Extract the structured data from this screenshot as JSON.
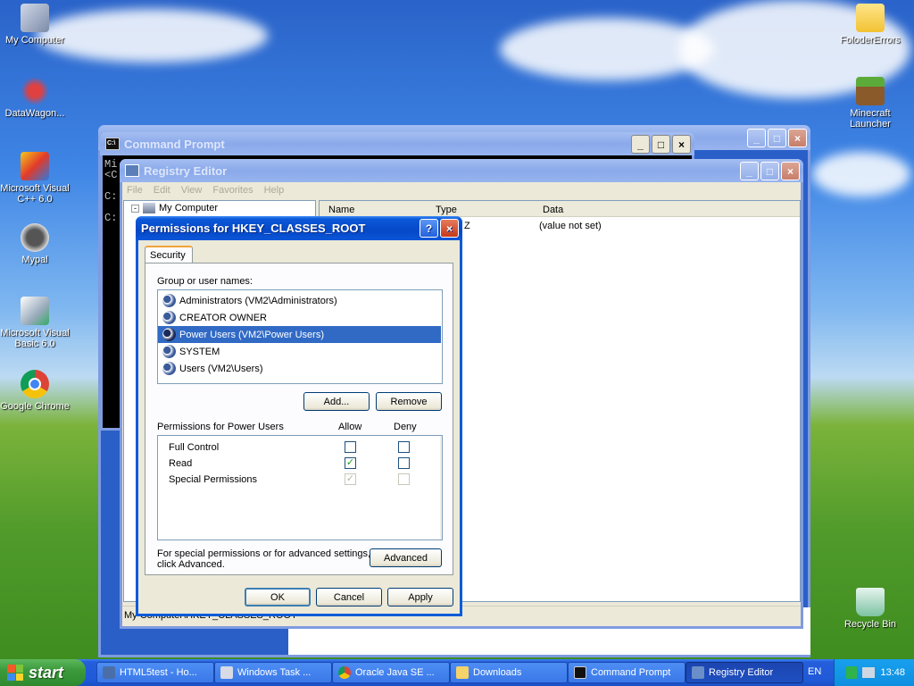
{
  "desktop": {
    "icons": [
      {
        "label": "My Computer"
      },
      {
        "label": "DataWagon..."
      },
      {
        "label": "Microsoft Visual C++ 6.0"
      },
      {
        "label": "Mypal"
      },
      {
        "label": "Microsoft Visual Basic 6.0"
      },
      {
        "label": "Google Chrome"
      },
      {
        "label": "FoloderErrors"
      },
      {
        "label": "Minecraft Launcher"
      },
      {
        "label": "Recycle Bin"
      }
    ]
  },
  "cmd": {
    "title": "Command Prompt",
    "lines": [
      "Mi",
      "<C",
      "",
      "C:",
      "",
      "C:"
    ]
  },
  "regedit": {
    "title": "Registry Editor",
    "menu": [
      "File",
      "Edit",
      "View",
      "Favorites",
      "Help"
    ],
    "tree_root": "My Computer",
    "columns": [
      "Name",
      "Type",
      "Data"
    ],
    "row_type_fragment": "Z",
    "row_data": "(value not set)",
    "status": "My Computer\\HKEY_CLASSES_ROOT"
  },
  "perm": {
    "title": "Permissions for HKEY_CLASSES_ROOT",
    "tab": "Security",
    "group_label": "Group or user names:",
    "users": [
      {
        "name": "Administrators (VM2\\Administrators)",
        "selected": false
      },
      {
        "name": "CREATOR OWNER",
        "selected": false
      },
      {
        "name": "Power Users (VM2\\Power Users)",
        "selected": true
      },
      {
        "name": "SYSTEM",
        "selected": false
      },
      {
        "name": "Users (VM2\\Users)",
        "selected": false
      }
    ],
    "add_label": "Add...",
    "remove_label": "Remove",
    "perms_label": "Permissions for Power Users",
    "allow_label": "Allow",
    "deny_label": "Deny",
    "perms": [
      {
        "name": "Full Control",
        "allow": "",
        "deny": ""
      },
      {
        "name": "Read",
        "allow": "✓",
        "deny": ""
      },
      {
        "name": "Special Permissions",
        "allow": "✓",
        "deny": ""
      }
    ],
    "special_text_1": "For special permissions or for advanced settings,",
    "special_text_2": "click Advanced.",
    "advanced_label": "Advanced",
    "ok_label": "OK",
    "cancel_label": "Cancel",
    "apply_label": "Apply"
  },
  "taskbar": {
    "start_label": "start",
    "tasks": [
      {
        "label": "HTML5test - Ho..."
      },
      {
        "label": "Windows Task ..."
      },
      {
        "label": "Oracle Java SE ..."
      },
      {
        "label": "Downloads"
      },
      {
        "label": "Command Prompt"
      },
      {
        "label": "Registry Editor"
      }
    ],
    "lang": "EN",
    "time": "13:48"
  }
}
